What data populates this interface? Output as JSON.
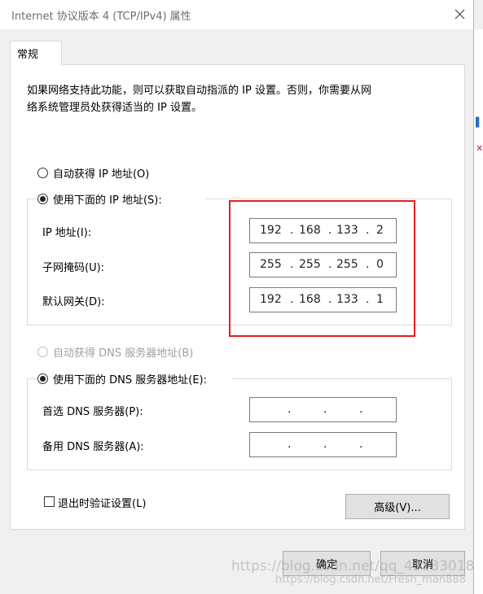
{
  "window": {
    "title": "Internet 协议版本 4 (TCP/IPv4) 属性"
  },
  "tabs": [
    {
      "label": "常规",
      "selected": true
    }
  ],
  "description": {
    "line1": "如果网络支持此功能，则可以获取自动指派的 IP 设置。否则，你需要从网",
    "line2": "络系统管理员处获得适当的 IP 设置。"
  },
  "ip_section": {
    "auto_option": {
      "label": "自动获得 IP 地址(O)",
      "checked": false
    },
    "manual_option": {
      "label": "使用下面的 IP 地址(S):",
      "checked": true
    },
    "fields": [
      {
        "label": "IP 地址(I):",
        "octets": [
          "192",
          "168",
          "133",
          "2"
        ]
      },
      {
        "label": "子网掩码(U):",
        "octets": [
          "255",
          "255",
          "255",
          "0"
        ]
      },
      {
        "label": "默认网关(D):",
        "octets": [
          "192",
          "168",
          "133",
          "1"
        ]
      }
    ]
  },
  "dns_section": {
    "auto_option": {
      "label": "自动获得 DNS 服务器地址(B)",
      "checked": false,
      "disabled": true
    },
    "manual_option": {
      "label": "使用下面的 DNS 服务器地址(E):",
      "checked": true
    },
    "fields": [
      {
        "label": "首选 DNS 服务器(P):",
        "octets": [
          "",
          "",
          "",
          ""
        ]
      },
      {
        "label": "备用 DNS 服务器(A):",
        "octets": [
          "",
          "",
          "",
          ""
        ]
      }
    ]
  },
  "validate_checkbox": {
    "label": "退出时验证设置(L)",
    "checked": false
  },
  "buttons": {
    "advanced": "高级(V)...",
    "ok": "确定",
    "cancel": "取消"
  },
  "watermark": {
    "line1": "https://blog.csdn.net/qq_43133018",
    "line2": "https://blog.csdn.net/Fresh_man888"
  },
  "colors": {
    "highlight_border": "#e02020",
    "dialog_bg": "#f0f0f0",
    "panel_bg": "#ffffff"
  }
}
